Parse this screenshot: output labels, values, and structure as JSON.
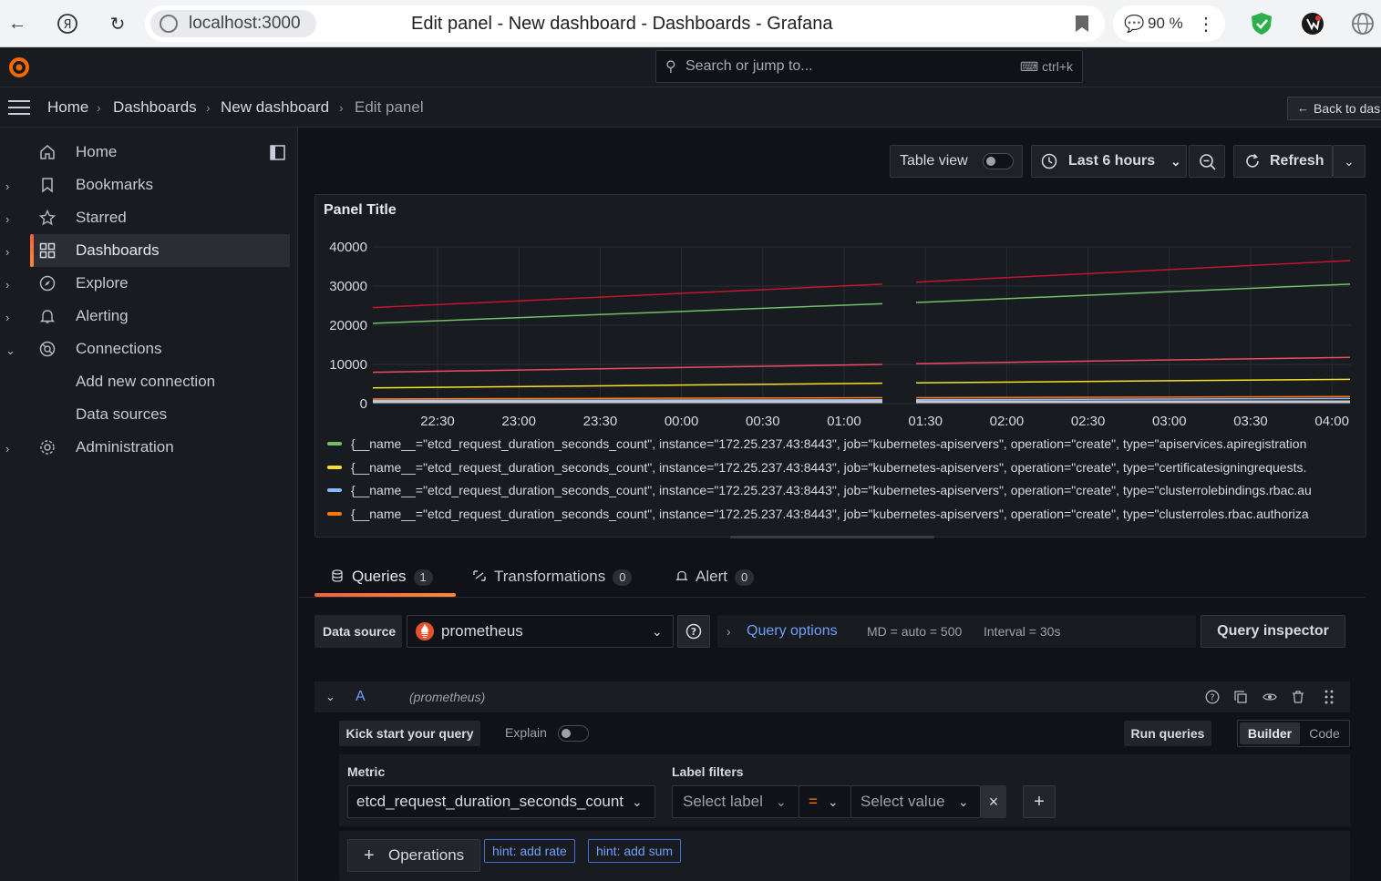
{
  "browser": {
    "url": "localhost:3000",
    "tab_title": "Edit panel - New dashboard - Dashboards - Grafana",
    "zoom": "90 %"
  },
  "topbar": {
    "search_placeholder": "Search or jump to...",
    "shortcut": "ctrl+k"
  },
  "breadcrumb": [
    "Home",
    "Dashboards",
    "New dashboard",
    "Edit panel"
  ],
  "back_button": "Back to das",
  "sidebar": {
    "items": [
      {
        "label": "Home",
        "icon": "home-icon"
      },
      {
        "label": "Bookmarks",
        "icon": "bookmark-icon"
      },
      {
        "label": "Starred",
        "icon": "star-icon"
      },
      {
        "label": "Dashboards",
        "icon": "apps-icon",
        "active": true
      },
      {
        "label": "Explore",
        "icon": "compass-icon"
      },
      {
        "label": "Alerting",
        "icon": "bell-icon"
      },
      {
        "label": "Connections",
        "icon": "connections-icon"
      },
      {
        "label": "Add new connection",
        "sub": true
      },
      {
        "label": "Data sources",
        "sub": true
      },
      {
        "label": "Administration",
        "icon": "gear-icon"
      }
    ]
  },
  "toolbar": {
    "table_view": "Table view",
    "time_range": "Last 6 hours",
    "refresh": "Refresh"
  },
  "panel": {
    "title": "Panel Title"
  },
  "chart_data": {
    "type": "line",
    "title": "Panel Title",
    "y_ticks": [
      "40000",
      "30000",
      "20000",
      "10000",
      "0"
    ],
    "ylim": [
      0,
      40000
    ],
    "x_ticks": [
      "22:30",
      "23:00",
      "23:30",
      "00:00",
      "00:30",
      "01:00",
      "01:30",
      "02:00",
      "02:30",
      "03:00",
      "03:30",
      "04:00"
    ],
    "grid": true,
    "legend_position": "bottom",
    "series": [
      {
        "name": "{__name__=\"etcd_request_duration_seconds_count\", instance=\"172.25.237.43:8443\", job=\"kubernetes-apiservers\", operation=\"create\", type=\"apiservices.apiregistration",
        "color": "#73bf69",
        "start": 20500,
        "gap_before": 25500,
        "gap_after": 25800,
        "end": 30500
      },
      {
        "name": "{__name__=\"etcd_request_duration_seconds_count\", instance=\"172.25.237.43:8443\", job=\"kubernetes-apiservers\", operation=\"create\", type=\"certificatesigningrequests.",
        "color": "#fade2a",
        "start": 4000,
        "gap_before": 5200,
        "gap_after": 5300,
        "end": 6200
      },
      {
        "name": "{__name__=\"etcd_request_duration_seconds_count\", instance=\"172.25.237.43:8443\", job=\"kubernetes-apiservers\", operation=\"create\", type=\"clusterrolebindings.rbac.au",
        "color": "#8ab8ff",
        "start": 800,
        "gap_before": 1000,
        "gap_after": 1000,
        "end": 1300
      },
      {
        "name": "{__name__=\"etcd_request_duration_seconds_count\", instance=\"172.25.237.43:8443\", job=\"kubernetes-apiservers\", operation=\"create\", type=\"clusterroles.rbac.authoriza",
        "color": "#ff780a",
        "start": 1200,
        "gap_before": 1500,
        "gap_after": 1500,
        "end": 1800
      },
      {
        "name": "",
        "color": "#c4162a",
        "start": 24500,
        "gap_before": 30500,
        "gap_after": 31000,
        "end": 36500
      },
      {
        "name": "",
        "color": "#f2495c",
        "start": 8000,
        "gap_before": 10000,
        "gap_after": 10200,
        "end": 11800
      }
    ]
  },
  "tabs": [
    {
      "label": "Queries",
      "count": "1"
    },
    {
      "label": "Transformations",
      "count": "0"
    },
    {
      "label": "Alert",
      "count": "0"
    }
  ],
  "query": {
    "data_source_label": "Data source",
    "data_source": "prometheus",
    "query_options": "Query options",
    "md": "MD = auto = 500",
    "interval": "Interval = 30s",
    "inspector": "Query inspector",
    "ref_id": "A",
    "ref_ds": "(prometheus)",
    "kick_start": "Kick start your query",
    "explain": "Explain",
    "run_queries": "Run queries",
    "builder": "Builder",
    "code": "Code",
    "metric_label": "Metric",
    "metric_value": "etcd_request_duration_seconds_count",
    "label_filters": "Label filters",
    "select_label": "Select label",
    "operator": "=",
    "select_value": "Select value",
    "operations": "Operations",
    "hint_rate": "hint: add rate",
    "hint_sum": "hint: add sum"
  }
}
